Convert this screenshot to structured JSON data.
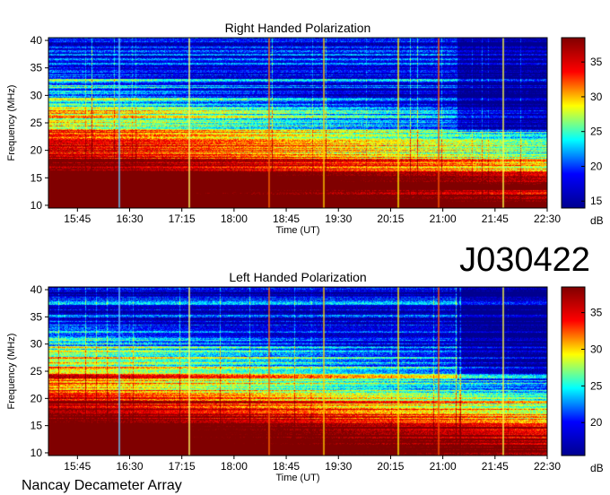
{
  "header": {
    "id_label": "J030422"
  },
  "footer": {
    "instrument_label": "Nancay Decameter Array"
  },
  "chart_data": [
    {
      "type": "heatmap",
      "title": "Right Handed Polarization",
      "xlabel": "Time (UT)",
      "ylabel": "Frequency (MHz)",
      "x_ticks": [
        "15:45",
        "16:30",
        "17:15",
        "18:00",
        "18:45",
        "19:30",
        "20:15",
        "21:00",
        "21:45",
        "22:30"
      ],
      "y_ticks": [
        10,
        15,
        20,
        25,
        30,
        35,
        40
      ],
      "xlim": [
        "15:20",
        "22:30"
      ],
      "ylim": [
        9.5,
        40.5
      ],
      "colorbar": {
        "label": "dB",
        "ticks": [
          15,
          20,
          25,
          30,
          35
        ],
        "range": [
          14,
          38.5
        ]
      },
      "colormap": [
        "#00008f",
        "#0000ff",
        "#00ffff",
        "#ffff00",
        "#ff0000",
        "#800000"
      ]
    },
    {
      "type": "heatmap",
      "title": "Left Handed Polarization",
      "xlabel": "Time (UT)",
      "ylabel": "Frequency (MHz)",
      "x_ticks": [
        "15:45",
        "16:30",
        "17:15",
        "18:00",
        "18:45",
        "19:30",
        "20:15",
        "21:00",
        "21:45",
        "22:30"
      ],
      "y_ticks": [
        10,
        15,
        20,
        25,
        30,
        35,
        40
      ],
      "xlim": [
        "15:20",
        "22:30"
      ],
      "ylim": [
        9.5,
        40.5
      ],
      "colorbar": {
        "label": "dB",
        "ticks": [
          20,
          25,
          30,
          35
        ],
        "range": [
          15.5,
          38.5
        ]
      },
      "colormap": [
        "#00008f",
        "#0000ff",
        "#00ffff",
        "#ffff00",
        "#ff0000",
        "#800000"
      ]
    }
  ]
}
